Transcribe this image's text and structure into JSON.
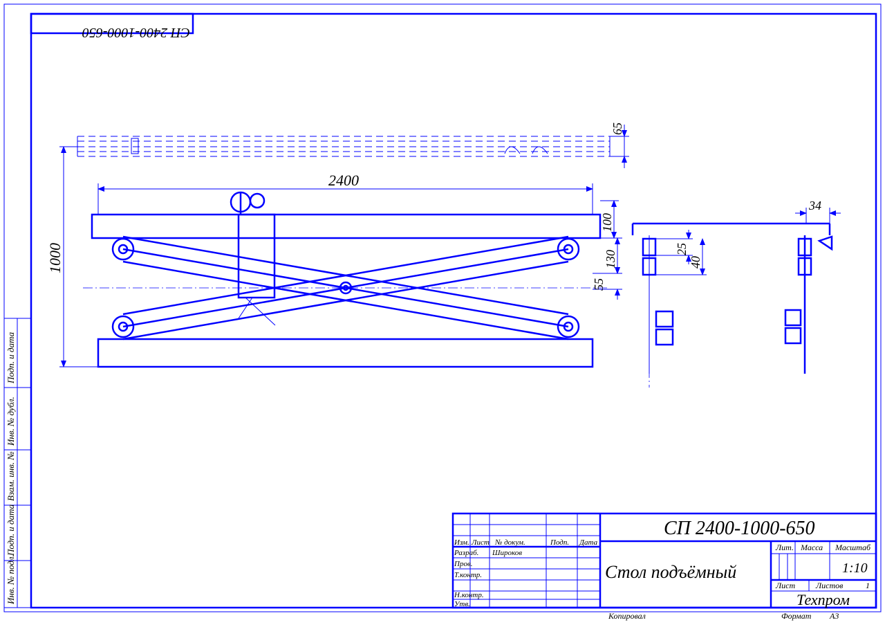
{
  "drawing": {
    "code": "СП 2400-1000-650",
    "code_rot": "СП 2400-1000-650",
    "title": "Стол подъёмный",
    "company": "Техпром"
  },
  "dimensions": {
    "d2400": "2400",
    "d1000": "1000",
    "d65": "65",
    "d100": "100",
    "d130": "130",
    "d55": "55",
    "d25": "25",
    "d40": "40",
    "d34": "34"
  },
  "titleblock": {
    "top_row": {
      "lit": "Лит.",
      "massa": "Масса",
      "masshtab": "Масштаб"
    },
    "scale": "1:10",
    "list": "Лист",
    "listov": "Листов",
    "listov_val": "1",
    "rev_headers": {
      "izm": "Изм.",
      "list": "Лист",
      "dokum": "№ докум.",
      "podp": "Подп.",
      "data": "Дата"
    },
    "roles": {
      "razrab": "Разраб.",
      "razrab_name": "Широков",
      "prov": "Пров.",
      "tkontr": "Т.контр.",
      "nkontr": "Н.контр.",
      "utv": "Утв."
    },
    "bottom": {
      "kopiroval": "Копировал",
      "format": "Формат",
      "format_val": "А3"
    }
  },
  "side_labels": {
    "a": "Инв. № подл.",
    "b": "Подп. и дата",
    "c": "Взам. инв. №",
    "d": "Инв. № дубл.",
    "e": "Подп. и дата"
  }
}
